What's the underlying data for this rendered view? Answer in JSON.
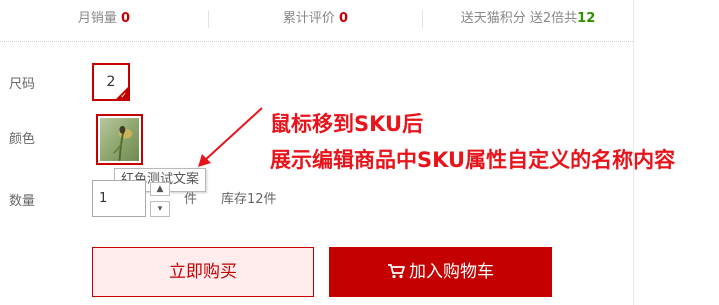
{
  "stats": {
    "monthly_sales_label": "月销量",
    "monthly_sales_value": "0",
    "reviews_label": "累计评价",
    "reviews_value": "0",
    "points_label": "送天猫积分 送2倍共",
    "points_value": "12"
  },
  "sku": {
    "size_label": "尺码",
    "size_value": "2",
    "color_label": "颜色",
    "color_tooltip": "红色测试文案"
  },
  "annotation": {
    "line1": "鼠标移到SKU后",
    "line2": "展示编辑商品中SKU属性自定义的名称内容"
  },
  "quantity": {
    "label": "数量",
    "value": "1",
    "unit": "件",
    "stock": "库存12件"
  },
  "actions": {
    "buy_now": "立即购买",
    "add_to_cart": "加入购物车"
  },
  "icons": {
    "selected_corner": "check-icon",
    "cart": "cart-icon",
    "qty_up": "chevron-up-icon",
    "qty_down": "chevron-down-icon"
  },
  "colors": {
    "brand_red": "#c40000",
    "annotation_red": "#e8141b",
    "points_green": "#2f8f00",
    "buy_bg": "#ffeded"
  }
}
